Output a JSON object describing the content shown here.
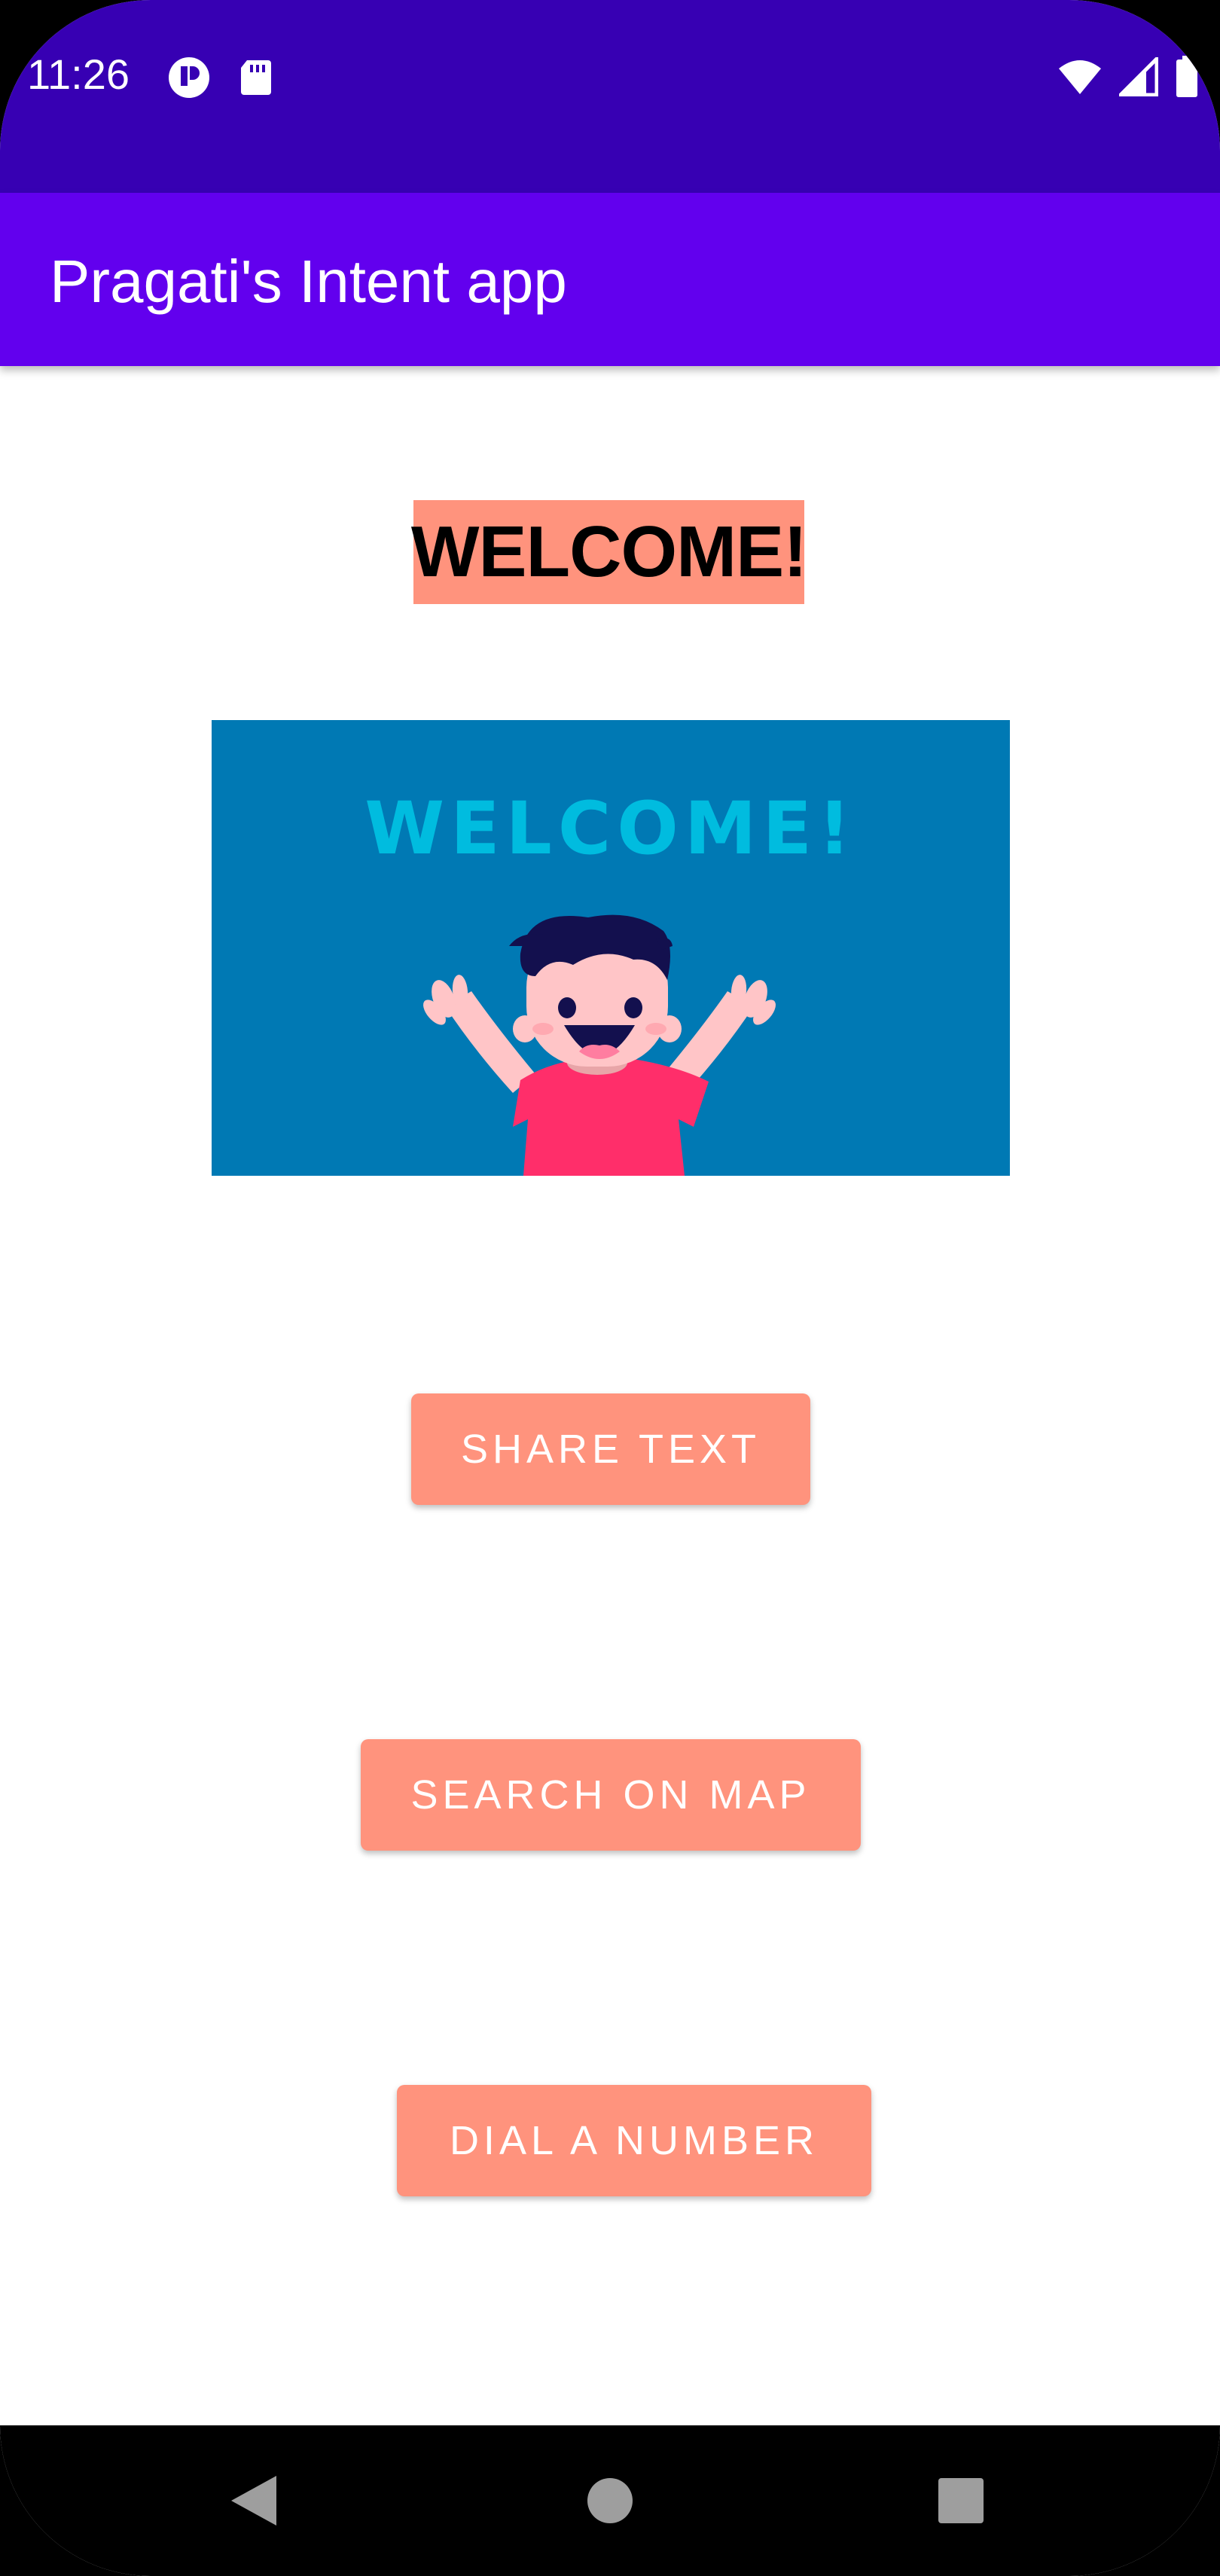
{
  "status_bar": {
    "time": "11:26",
    "left_icons": [
      "notification-app-icon",
      "sd-card-icon"
    ],
    "right_icons": [
      "wifi-icon",
      "signal-icon",
      "battery-icon"
    ]
  },
  "app_bar": {
    "title": "Pragati's Intent app"
  },
  "main": {
    "welcome_label": "WELCOME!",
    "banner": {
      "text": "WELCOME!",
      "icon": "waving-kid-illustration"
    },
    "buttons": [
      {
        "label": "SHARE TEXT"
      },
      {
        "label": "SEARCH ON MAP"
      },
      {
        "label": "DIAL A NUMBER"
      }
    ]
  },
  "nav_bar": {
    "buttons": [
      "back-icon",
      "home-icon",
      "recents-icon"
    ]
  },
  "colors": {
    "status_bar": "#3700b3",
    "app_bar": "#6200ee",
    "accent": "#ff937d",
    "banner_bg": "#0079b4",
    "banner_text": "#00bcdf"
  }
}
